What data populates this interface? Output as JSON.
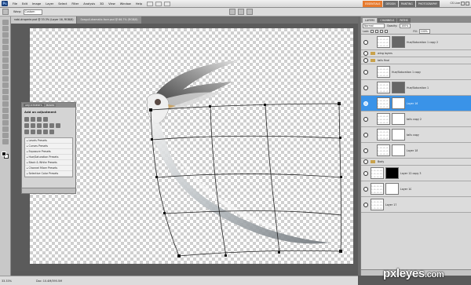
{
  "menubar": {
    "logo": "Ps",
    "items": [
      "File",
      "Edit",
      "Image",
      "Layer",
      "Select",
      "Filter",
      "Analysis",
      "3D",
      "View",
      "Window",
      "Help"
    ],
    "workspaces": [
      "ESSENTIALS",
      "DESIGN",
      "PAINTING",
      "PHOTOGRAPHY"
    ],
    "cs_live": "CS Live"
  },
  "optionsbar": {
    "warp_label": "Warp:",
    "warp_value": "Custom"
  },
  "document_tabs": [
    "nabi-draperie.psd @ 33.3% (Layer 16, RGB/8)",
    "Seagull-dramatic-face.psd @ 66.7% (RGB/8)"
  ],
  "statusbar": {
    "zoom": "33.33%",
    "doc": "Doc: 10.4M/395.5M"
  },
  "adjustments": {
    "tabs": [
      "ADJUSTMENTS",
      "MASKS"
    ],
    "heading": "Add an adjustment",
    "presets": [
      "Levels Presets",
      "Curves Presets",
      "Exposure Presets",
      "Hue/Saturation Presets",
      "Black & White Presets",
      "Channel Mixer Presets",
      "Selective Color Presets"
    ]
  },
  "layers_panel": {
    "tabs": [
      "LAYERS",
      "CHANNELS",
      "PATHS"
    ],
    "blend_mode": "Normal",
    "opacity_label": "Opacity:",
    "opacity": "100%",
    "fill_label": "Fill:",
    "fill": "100%",
    "lock_label": "Lock:",
    "layers": [
      {
        "name": "Hue/Saturation 1 copy 2",
        "kind": "adjustment",
        "selected": false
      },
      {
        "name": "wing layers",
        "kind": "group",
        "selected": false
      },
      {
        "name": "tails final",
        "kind": "group",
        "selected": false
      },
      {
        "name": "Hue/Saturation 1 copy",
        "kind": "layer",
        "selected": false
      },
      {
        "name": "Hue/Saturation 1",
        "kind": "adjustment",
        "selected": false
      },
      {
        "name": "Layer 16",
        "kind": "masked",
        "selected": true
      },
      {
        "name": "tails copy 2",
        "kind": "masked",
        "selected": false
      },
      {
        "name": "tails copy",
        "kind": "masked",
        "selected": false
      },
      {
        "name": "Layer 18",
        "kind": "masked",
        "selected": false
      },
      {
        "name": "Body",
        "kind": "group",
        "selected": false
      },
      {
        "name": "Layer 12 copy 3",
        "kind": "masked-dark",
        "selected": false
      },
      {
        "name": "Layer 10",
        "kind": "masked",
        "selected": false
      },
      {
        "name": "Layer 17",
        "kind": "layer",
        "selected": false
      }
    ]
  },
  "watermark": {
    "brand": "pxleyes",
    "tld": ".com"
  },
  "colors": {
    "selection_blue": "#3a93e8",
    "workspace_active": "#e67a2e",
    "canvas_checker": "#cfcfcf"
  }
}
